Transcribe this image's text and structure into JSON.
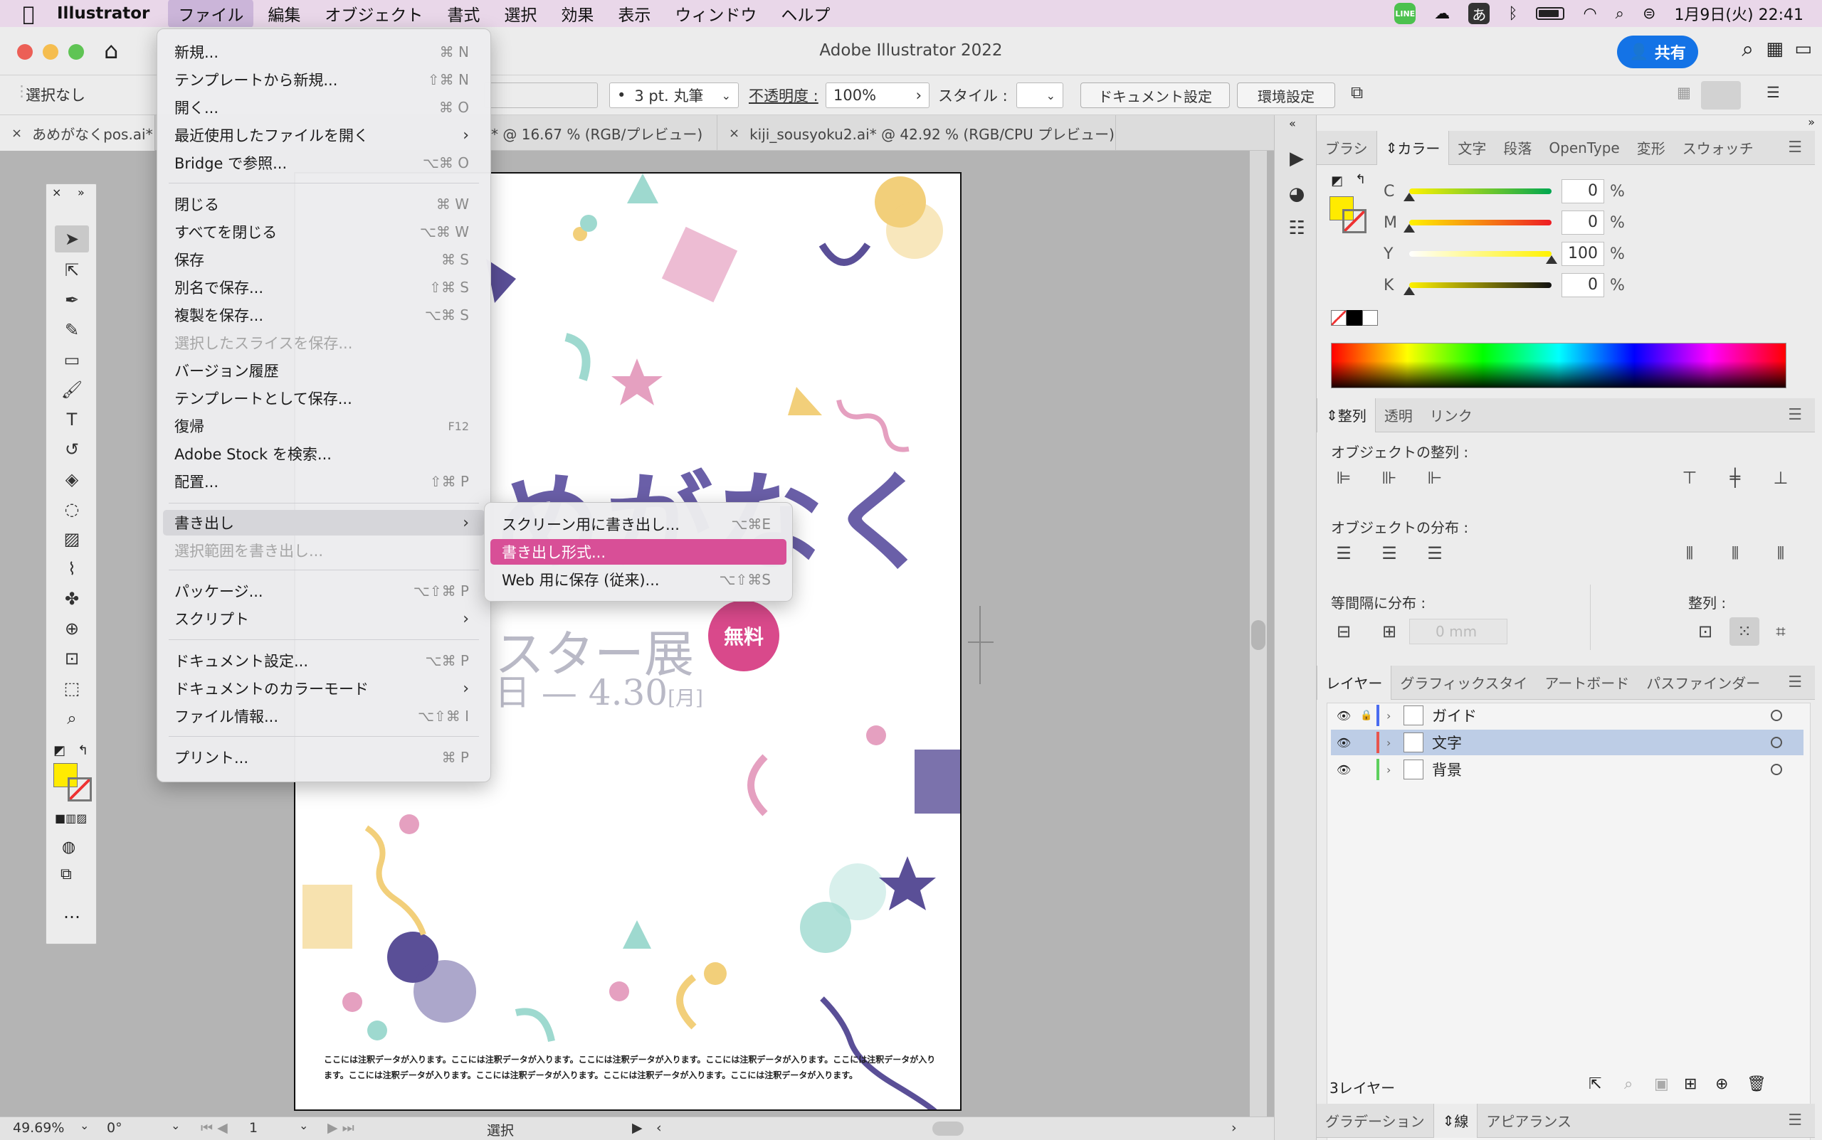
{
  "menubar": {
    "app_name": "Illustrator",
    "items": [
      "ファイル",
      "編集",
      "オブジェクト",
      "書式",
      "選択",
      "効果",
      "表示",
      "ウィンドウ",
      "ヘルプ"
    ],
    "status": {
      "ja_input": "あ",
      "datetime": "1月9日(火) 22:41",
      "line": "LINE"
    }
  },
  "titlebar": {
    "title": "Adobe Illustrator 2022",
    "share_label": "共有"
  },
  "controlbar": {
    "selection": "選択なし",
    "stroke": "3 pt. 丸筆",
    "opacity_label": "不透明度 :",
    "opacity_value": "100%",
    "style_label": "スタイル :",
    "doc_setup": "ドキュメント設定",
    "prefs": "環境設定"
  },
  "tabs": [
    {
      "label": "あめがなくpos.ai*"
    },
    {
      "label": "* @ 16.67 % (RGB/プレビュー)"
    },
    {
      "label": "kiji_sousyoku2.ai* @ 42.92 % (RGB/CPU プレビュー)"
    }
  ],
  "poster": {
    "title": "めがなく",
    "subtitle": "スター展",
    "date": "日 — 4.30",
    "date_day": "[月]",
    "badge": "無料",
    "fine_print": "ここには注釈データが入ります。ここには注釈データが入ります。ここには注釈データが入ります。ここには注釈データが入ります。ここには注釈データが入ります。ここには注釈データが入ります。ここには注釈データが入ります。ここには注釈データが入ります。ここには注釈データが入ります。"
  },
  "statusbar": {
    "zoom": "49.69%",
    "rotation": "0°",
    "page": "1",
    "mode": "選択"
  },
  "file_menu": [
    {
      "label": "新規...",
      "shortcut": "⌘ N"
    },
    {
      "label": "テンプレートから新規...",
      "shortcut": "⇧⌘ N"
    },
    {
      "label": "開く...",
      "shortcut": "⌘ O"
    },
    {
      "label": "最近使用したファイルを開く",
      "shortcut": "›"
    },
    {
      "label": "Bridge で参照...",
      "shortcut": "⌥⌘ O"
    },
    {
      "label": "閉じる",
      "shortcut": "⌘ W"
    },
    {
      "label": "すべてを閉じる",
      "shortcut": "⌥⌘ W"
    },
    {
      "label": "保存",
      "shortcut": "⌘ S"
    },
    {
      "label": "別名で保存...",
      "shortcut": "⇧⌘ S"
    },
    {
      "label": "複製を保存...",
      "shortcut": "⌥⌘ S"
    },
    {
      "label": "選択したスライスを保存...",
      "shortcut": ""
    },
    {
      "label": "バージョン履歴",
      "shortcut": ""
    },
    {
      "label": "テンプレートとして保存...",
      "shortcut": ""
    },
    {
      "label": "復帰",
      "shortcut": "F12"
    },
    {
      "label": "Adobe Stock を検索...",
      "shortcut": ""
    },
    {
      "label": "配置...",
      "shortcut": "⇧⌘ P"
    },
    {
      "label": "書き出し",
      "shortcut": "›"
    },
    {
      "label": "選択範囲を書き出し...",
      "shortcut": ""
    },
    {
      "label": "パッケージ...",
      "shortcut": "⌥⇧⌘ P"
    },
    {
      "label": "スクリプト",
      "shortcut": "›"
    },
    {
      "label": "ドキュメント設定...",
      "shortcut": "⌥⌘ P"
    },
    {
      "label": "ドキュメントのカラーモード",
      "shortcut": "›"
    },
    {
      "label": "ファイル情報...",
      "shortcut": "⌥⇧⌘ I"
    },
    {
      "label": "プリント...",
      "shortcut": "⌘ P"
    }
  ],
  "export_submenu": [
    {
      "label": "スクリーン用に書き出し...",
      "shortcut": "⌥⌘E"
    },
    {
      "label": "書き出し形式...",
      "shortcut": ""
    },
    {
      "label": "Web 用に保存 (従来)...",
      "shortcut": "⌥⇧⌘S"
    }
  ],
  "color_panel": {
    "tabs": [
      "ブラシ",
      "カラー",
      "文字",
      "段落",
      "OpenType",
      "変形",
      "スウォッチ"
    ],
    "cmyk": [
      {
        "label": "C",
        "value": "0",
        "unit": "%"
      },
      {
        "label": "M",
        "value": "0",
        "unit": "%"
      },
      {
        "label": "Y",
        "value": "100",
        "unit": "%"
      },
      {
        "label": "K",
        "value": "0",
        "unit": "%"
      }
    ],
    "fill_color": "#ffeb00"
  },
  "align_panel": {
    "tabs": [
      "整列",
      "透明",
      "リンク"
    ],
    "align_objects": "オブジェクトの整列 :",
    "distribute_objects": "オブジェクトの分布 :",
    "distribute_spacing": "等間隔に分布 :",
    "align_to": "整列 :",
    "spacing_value": "0 mm"
  },
  "layers_panel": {
    "tabs": [
      "レイヤー",
      "グラフィックスタイ",
      "アートボード",
      "パスファインダー"
    ],
    "layers": [
      {
        "name": "ガイド",
        "color": "#4a6cf0",
        "locked": true,
        "selected": false
      },
      {
        "name": "文字",
        "color": "#e8554e",
        "locked": false,
        "selected": true
      },
      {
        "name": "背景",
        "color": "#5ed05e",
        "locked": false,
        "selected": false
      }
    ],
    "count": "3レイヤー"
  },
  "bottom_panel": {
    "tabs": [
      "グラデーション",
      "線",
      "アピアランス"
    ]
  },
  "colors": {
    "menu_highlight": "#d84f97",
    "accent_blue": "#1473e6",
    "menubar_bg": "#e9d7e9"
  }
}
